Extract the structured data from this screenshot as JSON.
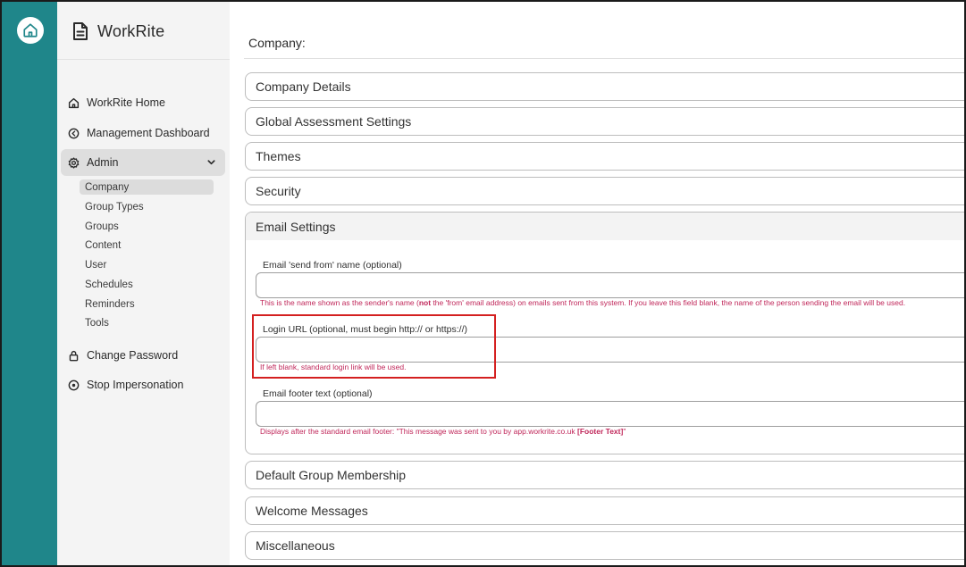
{
  "app": {
    "name": "WorkRite"
  },
  "sidebar": {
    "items": [
      {
        "label": "WorkRite Home",
        "icon": "house-icon"
      },
      {
        "label": "Management Dashboard",
        "icon": "back-circle-icon"
      },
      {
        "label": "Admin",
        "icon": "gear-icon",
        "expanded": true
      },
      {
        "label": "Change Password",
        "icon": "lock-icon"
      },
      {
        "label": "Stop Impersonation",
        "icon": "stop-circle-icon"
      }
    ],
    "admin_sub": [
      "Company",
      "Group Types",
      "Groups",
      "Content",
      "User",
      "Schedules",
      "Reminders",
      "Tools"
    ],
    "active_sub": "Company"
  },
  "main": {
    "title": "Company:",
    "panels_top": [
      "Company Details",
      "Global Assessment Settings",
      "Themes",
      "Security"
    ],
    "email_panel": {
      "title": "Email Settings",
      "send_from": {
        "label": "Email 'send from' name (optional)",
        "value": "",
        "help_pre": "This is the name shown as the sender's name (",
        "help_bold": "not",
        "help_post": " the 'from' email address) on emails sent from this system. If you leave this field blank, the name of the person sending the email will be used."
      },
      "login_url": {
        "label": "Login URL (optional, must begin http:// or https://)",
        "value": "",
        "help": "If left blank, standard login link will be used."
      },
      "footer": {
        "label": "Email footer text (optional)",
        "value": "",
        "help_pre": "Displays after the standard email footer: \"This message was sent to you by app.workrite.co.uk ",
        "help_bold": "[Footer Text]",
        "help_post": "\""
      }
    },
    "panels_bottom": [
      "Default Group Membership",
      "Welcome Messages",
      "Miscellaneous"
    ]
  },
  "colors": {
    "rail": "#1f868a",
    "help_text": "#c0275a",
    "highlight": "#d42020"
  }
}
